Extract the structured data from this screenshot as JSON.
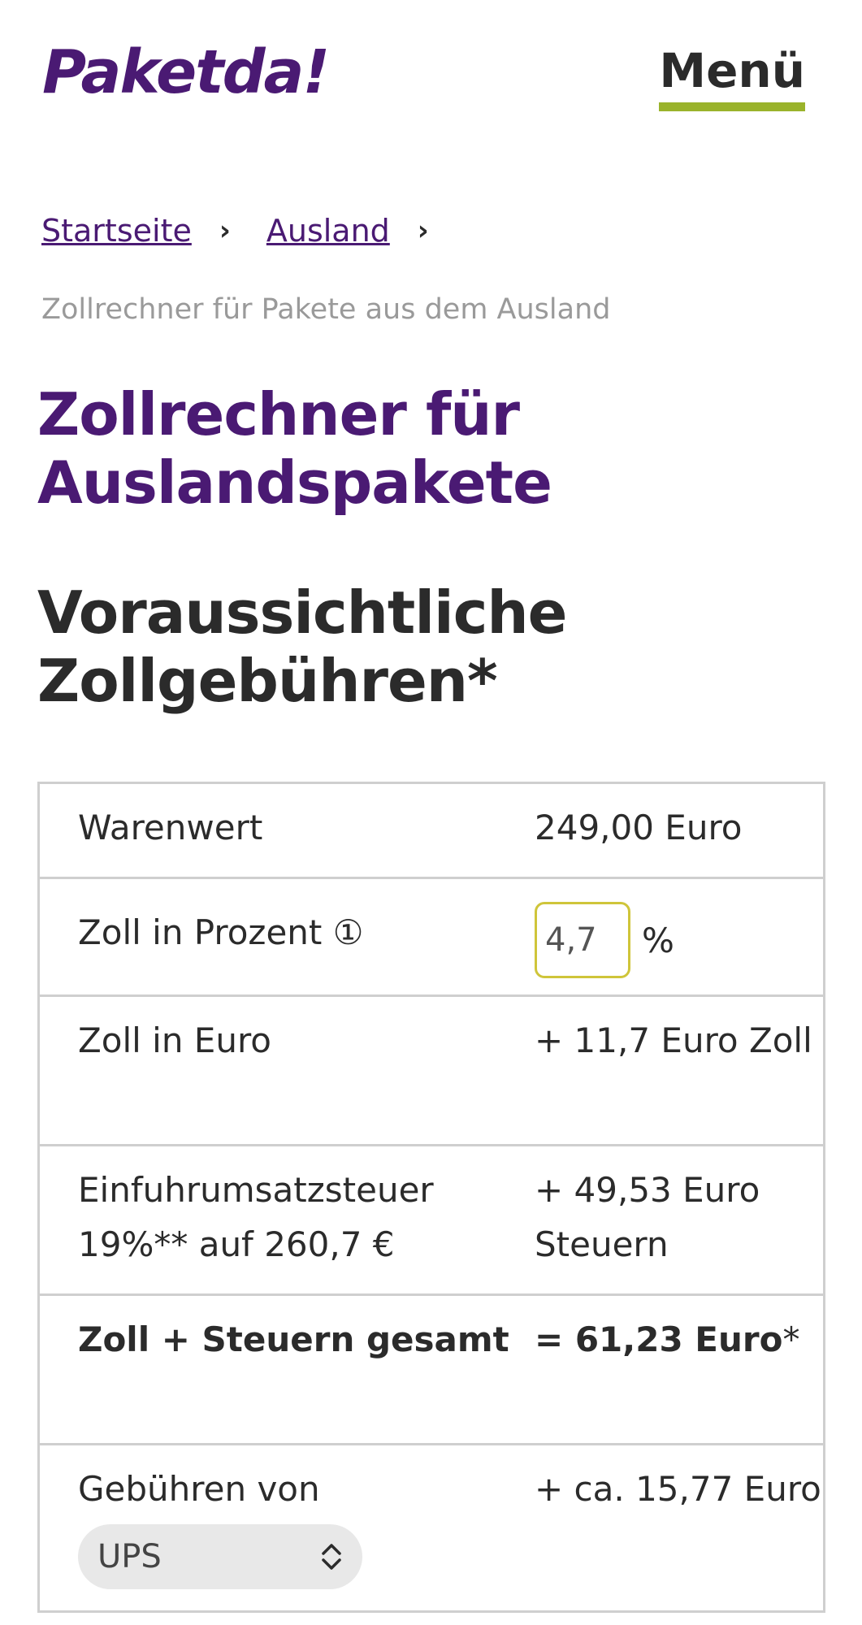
{
  "header": {
    "logo": "Paketda!",
    "menu_label": "Menü",
    "accent_color": "#9ab32b",
    "brand_color": "#4a1a73"
  },
  "breadcrumb": {
    "items": [
      "Startseite",
      "Ausland"
    ],
    "separator": "›"
  },
  "subline": "Zollrechner für Pakete aus dem Ausland",
  "page_title": "Zollrechner für Auslandspakete",
  "section_title": "Voraussichtliche Zollgebühren*",
  "table": {
    "warenwert_label": "Warenwert",
    "warenwert_value": "249,00 Euro",
    "zoll_prozent_label": "Zoll in Prozent",
    "info_icon": "①",
    "zoll_prozent_value": "4,7",
    "percent_sign": "%",
    "zoll_euro_label": "Zoll in Euro",
    "zoll_euro_value": "+ 11,7 Euro Zoll",
    "eust_label": "Einfuhrumsatzsteuer 19%** auf 260,7 €",
    "eust_value": "+ 49,53 Euro Steuern",
    "gesamt_label": "Zoll + Steuern gesamt",
    "gesamt_value": "= 61,23 Euro",
    "gesamt_asterisk": "*",
    "gebuehren_label": "Gebühren von",
    "carrier_selected": "UPS",
    "gebuehren_value": "+ ca. 15,77 Euro"
  }
}
